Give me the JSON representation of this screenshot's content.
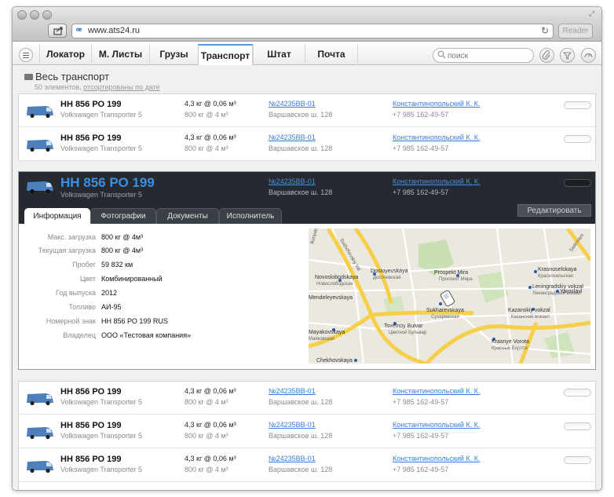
{
  "browser": {
    "url": "www.ats24.ru",
    "reader_label": "Reader"
  },
  "nav": {
    "tabs": [
      {
        "label": "Локатор"
      },
      {
        "label": "М. Листы"
      },
      {
        "label": "Грузы"
      },
      {
        "label": "Транспорт",
        "active": true
      },
      {
        "label": "Штат"
      },
      {
        "label": "Почта"
      }
    ],
    "search_placeholder": "поиск"
  },
  "section": {
    "title": "Весь транспорт",
    "count_text": "50 элементов,",
    "sort_link": "отсортированы по дате"
  },
  "rows_top": [
    {
      "plate": "НН 856 РО 199",
      "model": "Volkswagen Transporter 5",
      "load1": "4,3 кг @ 0,06 м³",
      "load2": "800 кг @ 4 м³",
      "waybill": "№24235ВВ-01",
      "address": "Варшавское ш. 128",
      "person": "Константинопольский К. К.",
      "phone": "+7 985 162-49-57"
    },
    {
      "plate": "НН 856 РО 199",
      "model": "Volkswagen Transporter 5",
      "load1": "4,3 кг @ 0,06 м³",
      "load2": "800 кг @ 4 м³",
      "waybill": "№24235ВВ-01",
      "address": "Варшавское ш. 128",
      "person": "Константинопольский К. К.",
      "phone": "+7 985 162-49-57"
    }
  ],
  "expanded": {
    "plate": "НН 856 РО 199",
    "model": "Volkswagen Transporter 5",
    "waybill": "№24235ВВ-01",
    "address": "Варшавское ш. 128",
    "person": "Константинопольский К. К.",
    "phone": "+7 985 162-49-57",
    "subtabs": [
      {
        "label": "Информация",
        "active": true
      },
      {
        "label": "Фотографии"
      },
      {
        "label": "Документы"
      },
      {
        "label": "Исполнитель"
      }
    ],
    "edit_label": "Редактировать",
    "details": [
      {
        "label": "Макс. загрузка",
        "value": "800 кг @ 4м³"
      },
      {
        "label": "Текущая загрузка",
        "value": "800 кг @ 4м³"
      },
      {
        "label": "Пробег",
        "value": "59 832 км"
      },
      {
        "label": "Цвет",
        "value": "Комбинированный"
      },
      {
        "label": "Год выпуска",
        "value": "2012"
      },
      {
        "label": "Топливо",
        "value": "АИ-95"
      },
      {
        "label": "Номерной знак",
        "value": "НН 856 РО 199 RUS"
      },
      {
        "label": "Владелец",
        "value": "ООО «Тестовая компания»"
      }
    ],
    "map_labels": [
      {
        "en": "Novoslobodskaya",
        "ru": "Новослободская"
      },
      {
        "en": "Dostoyevskaya",
        "ru": "Достоевская"
      },
      {
        "en": "Prospekt Mira",
        "ru": "Проспект Мира"
      },
      {
        "en": "Krasnoselskaya",
        "ru": "Красносельская"
      },
      {
        "en": "Leningradskiy vokzal",
        "ru": "Ленинградский вокзал"
      },
      {
        "en": "Yaroslavlenskiy",
        "ru": "Ярославский"
      },
      {
        "en": "Mendeleyevskaya",
        "ru": ""
      },
      {
        "en": "Sukharevskaya",
        "ru": "Сухаревская"
      },
      {
        "en": "Kazanskiy vokzal",
        "ru": "Казанский вокзал"
      },
      {
        "en": "Tsvetnoy Bulvar",
        "ru": "Цветной Бульвар"
      },
      {
        "en": "Mayakovskaya",
        "ru": "Маяковская"
      },
      {
        "en": "Krasnye Vorota",
        "ru": "Красные Ворота"
      },
      {
        "en": "Chekhovskaya",
        "ru": "Чеховская"
      },
      {
        "en": "Sadovaya",
        "ru": ""
      },
      {
        "en": "Sushchevskiy Val",
        "ru": ""
      },
      {
        "en": "Bunyatskiy Val",
        "ru": ""
      }
    ]
  },
  "rows_bottom": [
    {
      "plate": "НН 856 РО 199",
      "model": "Volkswagen Transporter 5",
      "load1": "4,3 кг @ 0,06 м³",
      "load2": "800 кг @ 4 м³",
      "waybill": "№24235ВВ-01",
      "address": "Варшавское ш. 128",
      "person": "Константинопольский К. К.",
      "phone": "+7 985 162-49-57"
    },
    {
      "plate": "НН 856 РО 199",
      "model": "Volkswagen Transporter 5",
      "load1": "4,3 кг @ 0,06 м³",
      "load2": "800 кг @ 4 м³",
      "waybill": "№24235ВВ-01",
      "address": "Варшавское ш. 128",
      "person": "Константинопольский К. К.",
      "phone": "+7 985 162-49-57"
    },
    {
      "plate": "НН 856 РО 199",
      "model": "Volkswagen Transporter 5",
      "load1": "4,3 кг @ 0,06 м³",
      "load2": "800 кг @ 4 м³",
      "waybill": "№24235ВВ-01",
      "address": "Варшавское ш. 128",
      "person": "Константинопольский К. К.",
      "phone": "+7 985 162-49-57"
    }
  ],
  "colors": {
    "accent": "#5e9bd6",
    "link": "#3a7bd5",
    "dark_header": "#262a30"
  }
}
